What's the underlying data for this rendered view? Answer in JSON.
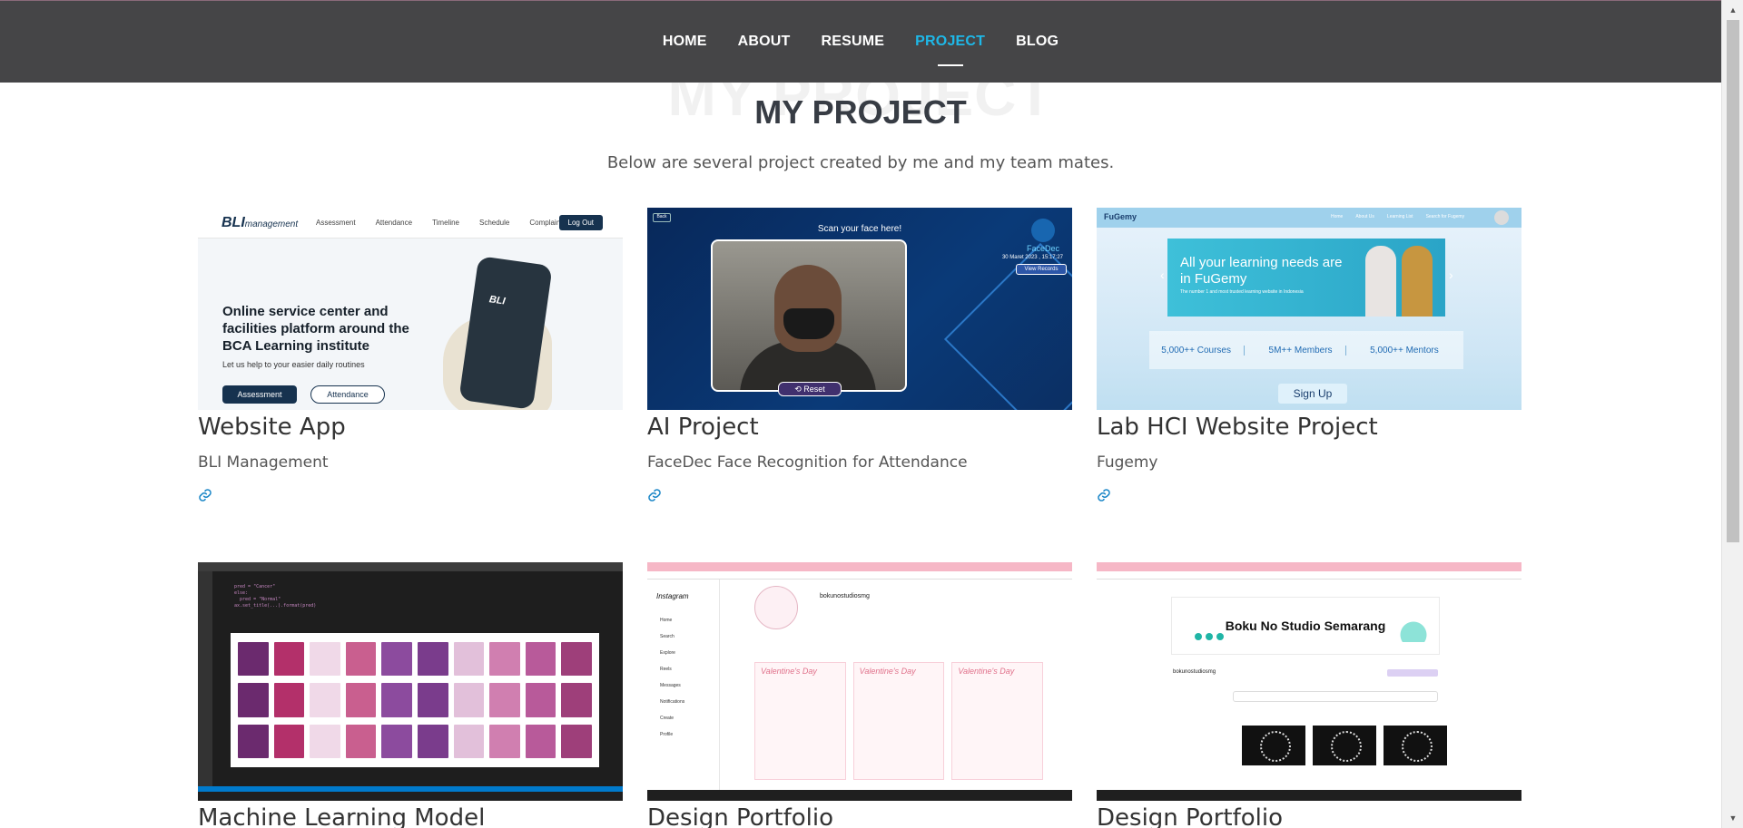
{
  "nav": {
    "items": [
      {
        "label": "HOME",
        "active": false
      },
      {
        "label": "ABOUT",
        "active": false
      },
      {
        "label": "RESUME",
        "active": false
      },
      {
        "label": "PROJECT",
        "active": true
      },
      {
        "label": "BLOG",
        "active": false
      }
    ],
    "active_color": "#1eb8e8"
  },
  "header": {
    "bg_title": "MY PROJECT",
    "title": "MY PROJECT",
    "subtitle": "Below are several project created by me and my team mates."
  },
  "projects": [
    {
      "title": "Website App",
      "desc": "BLI Management",
      "link_icon": "link-icon"
    },
    {
      "title": "AI Project",
      "desc": "FaceDec Face Recognition for Attendance",
      "link_icon": "link-icon"
    },
    {
      "title": "Lab HCI Website Project",
      "desc": "Fugemy",
      "link_icon": "link-icon"
    },
    {
      "title": "Machine Learning Model"
    },
    {
      "title": "Design Portfolio"
    },
    {
      "title": "Design Portfolio"
    }
  ],
  "thumb_bli": {
    "logo": "BLI",
    "logo_sub": "management",
    "menu": [
      "Assessment",
      "Attendance",
      "Timeline",
      "Schedule",
      "Complain"
    ],
    "logout": "Log Out",
    "headline": "Online service center and facilities platform around the BCA Learning institute",
    "sub": "Let us help to your easier daily routines",
    "btn1": "Assessment",
    "btn2": "Attendance"
  },
  "thumb_facedec": {
    "scan": "Scan your face here!",
    "brand": "FaceDec",
    "date": "30 Maret 2023 , 15:17:27",
    "view": "View Records",
    "reset": "Reset",
    "back": "Back"
  },
  "thumb_fugemy": {
    "brand": "FuGemy",
    "links": [
      "Home",
      "About Us",
      "Learning List",
      "Search for Fugemy"
    ],
    "headline": "All your learning needs are in FuGemy",
    "sub": "The number 1 and most trusted learning website in Indonesia",
    "stats": [
      "5,000++ Courses",
      "5M++ Members",
      "5,000++ Mentors"
    ],
    "signup": "Sign Up"
  },
  "thumb_ig": {
    "logo": "Instagram",
    "menu": [
      "Home",
      "Search",
      "Explore",
      "Reels",
      "Messages",
      "Notifications",
      "Create",
      "Profile"
    ],
    "username": "bokunostudiosmg"
  },
  "thumb_studio": {
    "banner": "Boku No Studio Semarang",
    "username": "bokunostudiosmg"
  }
}
